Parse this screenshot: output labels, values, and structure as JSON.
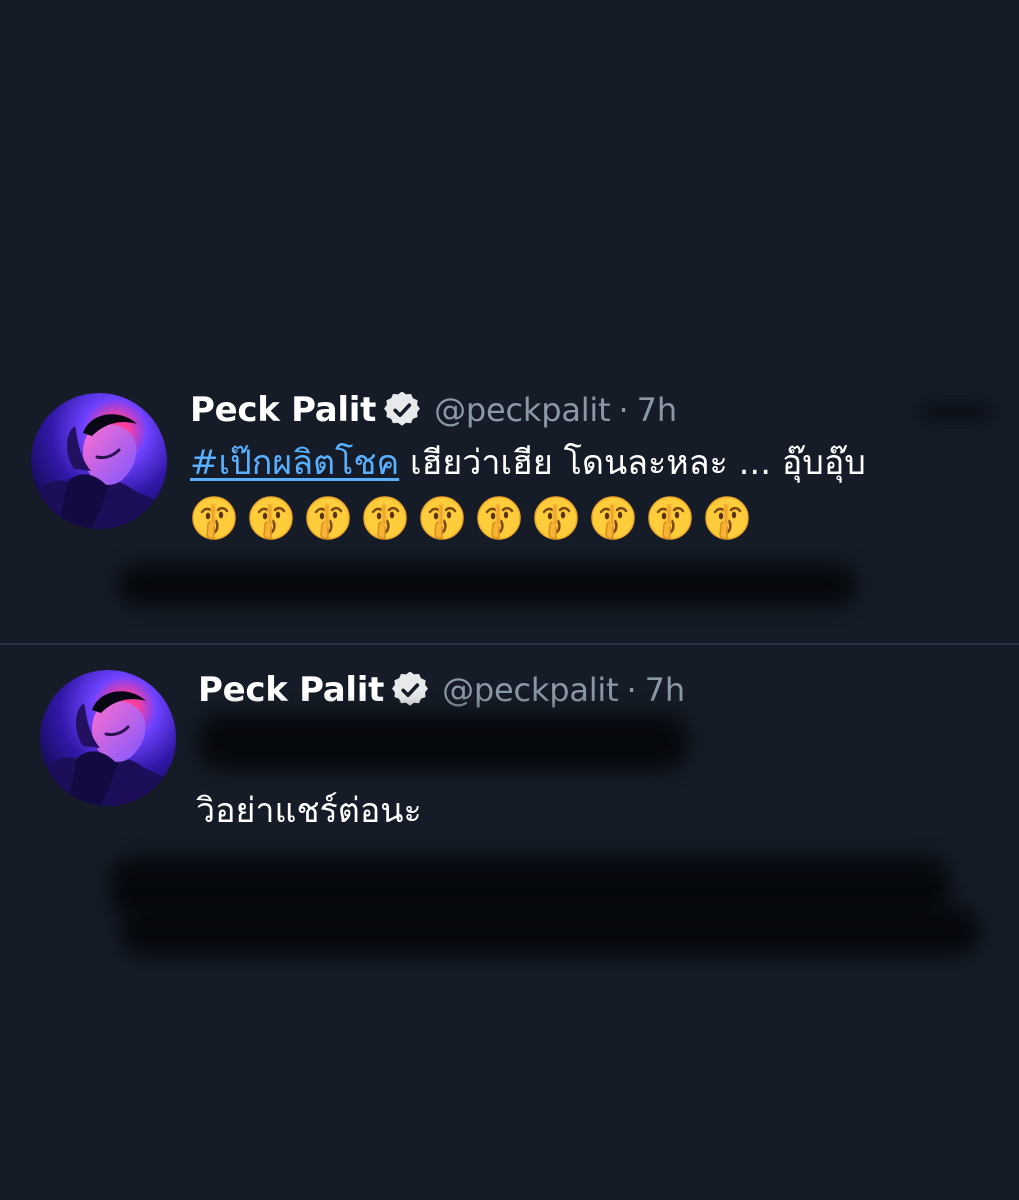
{
  "tweets": [
    {
      "author": {
        "display_name": "Peck Palit",
        "handle": "@peckpalit",
        "verified_icon": "verified-badge-icon"
      },
      "time": "7h",
      "separator": "·",
      "hashtag": "#เป๊กผลิตโชค",
      "text": "เฮียว่าเฮีย โดนละหละ ...  อุ๊บอุ๊บ",
      "emoji": "shushing-face",
      "emoji_count": 10
    },
    {
      "author": {
        "display_name": "Peck Palit",
        "handle": "@peckpalit",
        "verified_icon": "verified-badge-icon"
      },
      "time": "7h",
      "separator": "·",
      "text": "วิอย่าแชร์ต่อนะ"
    }
  ],
  "theme": {
    "background": "#151c27",
    "text": "#ffffff",
    "muted": "#8b98a5",
    "link": "#58b0ff"
  }
}
